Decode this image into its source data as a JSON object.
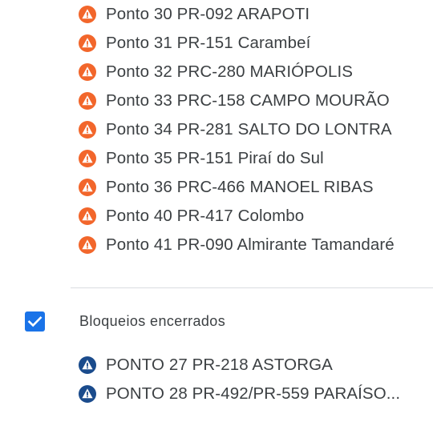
{
  "active_items": [
    {
      "label": "Ponto 30 PR-092 ARAPOTI",
      "icon": "warning-orange-icon"
    },
    {
      "label": "Ponto 31 PR-151 Carambeí",
      "icon": "warning-orange-icon"
    },
    {
      "label": "Ponto 32 PRC-280 MARIÓPOLIS",
      "icon": "warning-orange-icon"
    },
    {
      "label": "Ponto 33 PRC-158 CAMPO MOURÃO",
      "icon": "warning-orange-icon"
    },
    {
      "label": "Ponto 34 PR-281 SALTO DO LONTRA",
      "icon": "warning-orange-icon"
    },
    {
      "label": "Ponto 35 PR-151 Piraí do Sul",
      "icon": "warning-orange-icon"
    },
    {
      "label": "Ponto 36 PRC-466 MANOEL RIBAS",
      "icon": "warning-orange-icon"
    },
    {
      "label": "Ponto 40 PR-417 Colombo",
      "icon": "warning-orange-icon"
    },
    {
      "label": "Ponto 41 PR-090 Almirante Tamandaré",
      "icon": "warning-orange-icon"
    }
  ],
  "closed_section": {
    "title": "Bloqueios encerrados",
    "checked": true,
    "items": [
      {
        "label": "PONTO 27 PR-218 ASTORGA",
        "icon": "warning-blue-icon"
      },
      {
        "label": "PONTO 28 PR-492/PR-559 PARAÍSO...",
        "icon": "warning-blue-icon"
      }
    ]
  },
  "colors": {
    "active_icon": "#f2662b",
    "closed_icon": "#1a4b8c",
    "checkbox": "#1a73e8",
    "text": "#3c4043",
    "divider": "#dadce0"
  }
}
